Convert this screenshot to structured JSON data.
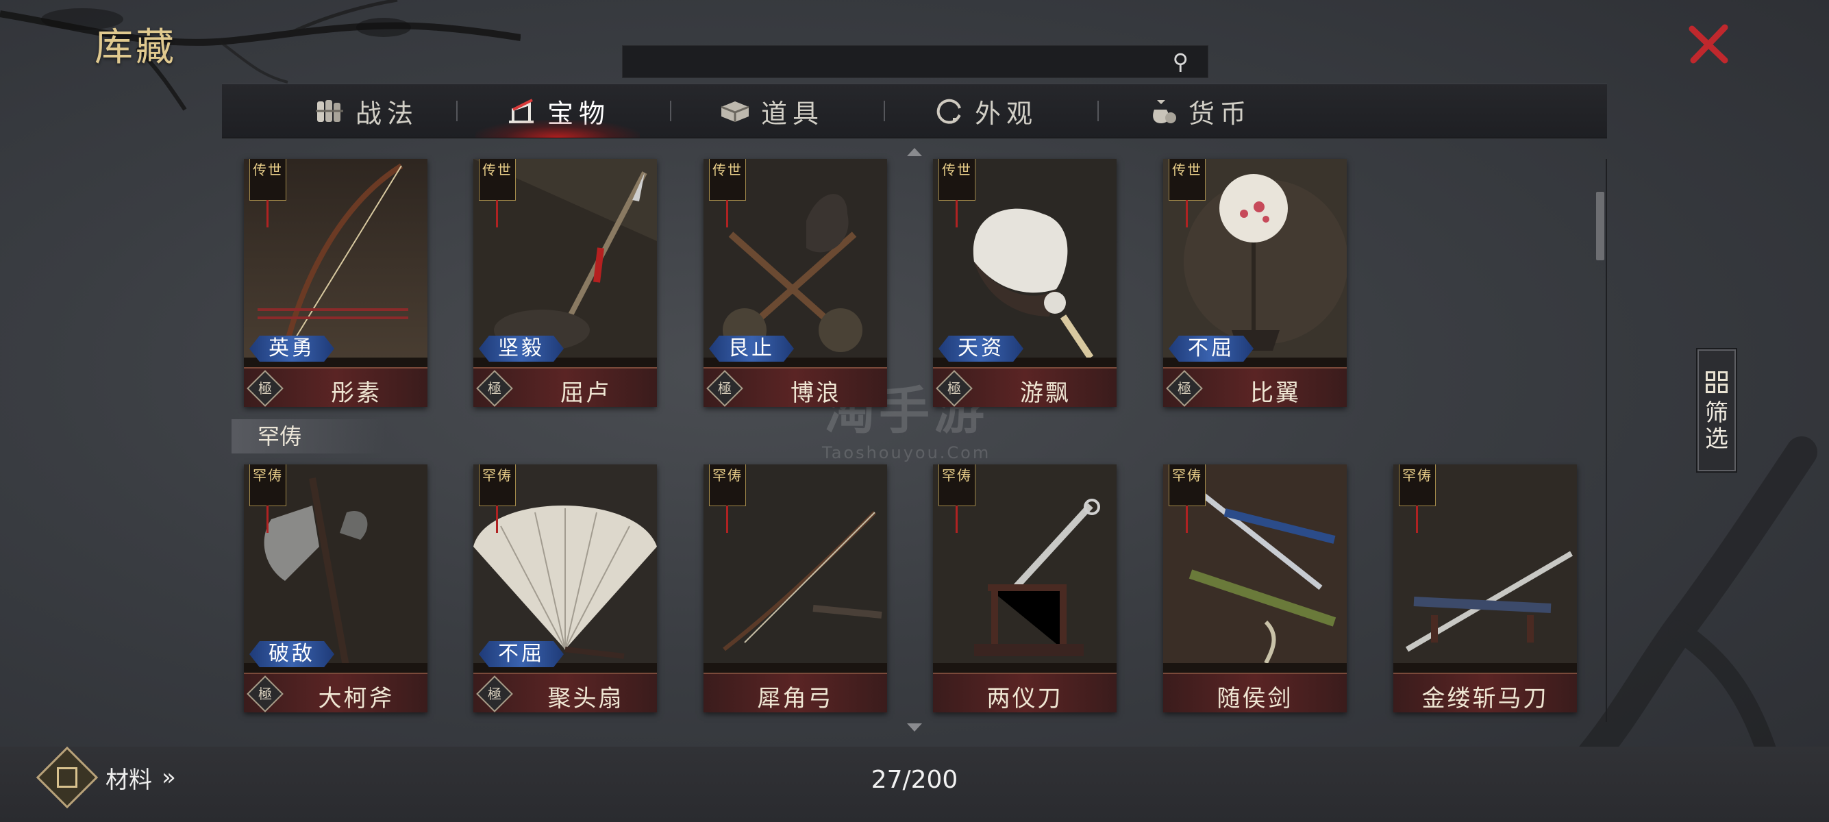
{
  "window": {
    "title": "库藏"
  },
  "search": {
    "icon_name": "search-icon",
    "icon_glyph": "⚲"
  },
  "tabs": [
    {
      "label": "战法",
      "icon": "scroll-bundle-icon",
      "active": false
    },
    {
      "label": "宝物",
      "icon": "treasure-icon",
      "active": true
    },
    {
      "label": "道具",
      "icon": "chest-icon",
      "active": false
    },
    {
      "label": "外观",
      "icon": "swirl-icon",
      "active": false
    },
    {
      "label": "货币",
      "icon": "money-bag-icon",
      "active": false
    }
  ],
  "row1": [
    {
      "name": "彤素",
      "trait": "英勇",
      "tag": "传世",
      "quality": "極",
      "art": "bow"
    },
    {
      "name": "屈卢",
      "trait": "坚毅",
      "tag": "传世",
      "quality": "極",
      "art": "spear"
    },
    {
      "name": "博浪",
      "trait": "艮止",
      "tag": "传世",
      "quality": "極",
      "art": "hammers"
    },
    {
      "name": "游飘",
      "trait": "天资",
      "tag": "传世",
      "quality": "極",
      "art": "feather-fan"
    },
    {
      "name": "比翼",
      "trait": "不屈",
      "tag": "传世",
      "quality": "極",
      "art": "round-fan"
    }
  ],
  "section": {
    "label": "罕俦"
  },
  "row2": [
    {
      "name": "大柯斧",
      "trait": "破敌",
      "tag": "罕俦",
      "quality": "極",
      "art": "axe"
    },
    {
      "name": "聚头扇",
      "trait": "不屈",
      "tag": "罕俦",
      "quality": "極",
      "art": "folding-fan"
    },
    {
      "name": "犀角弓",
      "trait": "",
      "tag": "罕俦",
      "quality": "",
      "art": "crossbow"
    },
    {
      "name": "两仪刀",
      "trait": "",
      "tag": "罕俦",
      "quality": "",
      "art": "dao"
    },
    {
      "name": "随侯剑",
      "trait": "",
      "tag": "罕俦",
      "quality": "",
      "art": "sword"
    },
    {
      "name": "金缕斩马刀",
      "trait": "",
      "tag": "罕俦",
      "quality": "",
      "art": "long-blade"
    }
  ],
  "filter": {
    "label": "筛选"
  },
  "materials": {
    "label": "材料",
    "chevron": "»"
  },
  "footer": {
    "count": "27/200"
  },
  "watermark": {
    "main": "淘手游",
    "sub": "Taoshouyou.Com"
  },
  "colors": {
    "accent_red": "#c0282d",
    "title_gold": "#e0c98f",
    "trait_blue": "#3a63b0",
    "name_bar": "#5a2424"
  }
}
